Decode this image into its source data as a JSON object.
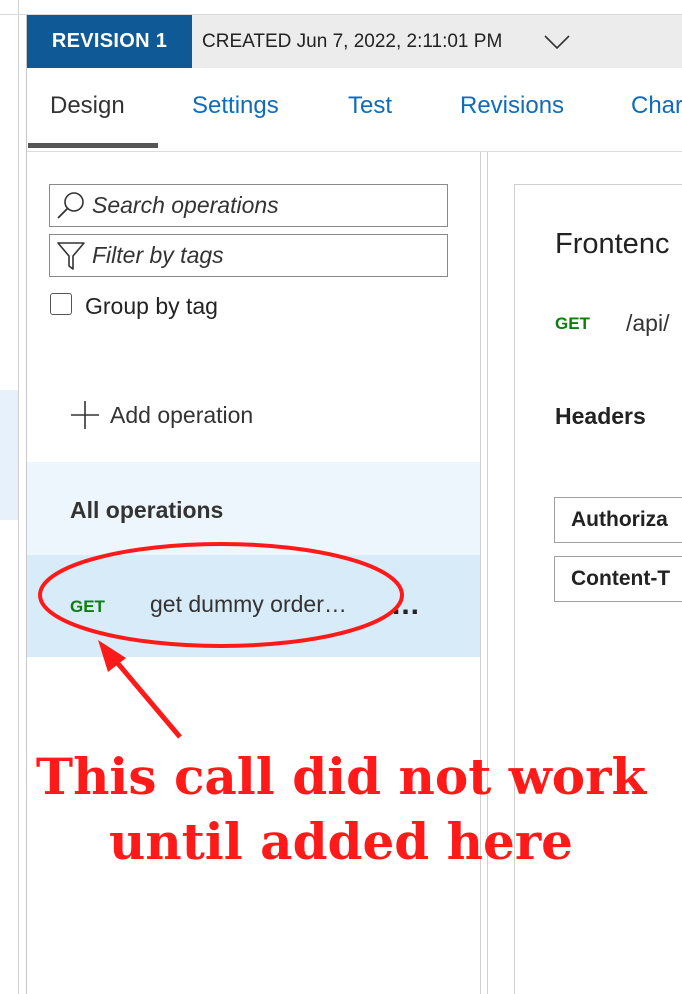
{
  "revision": {
    "badge": "REVISION 1",
    "created": "CREATED Jun 7, 2022, 2:11:01 PM"
  },
  "tabs": [
    {
      "label": "Design",
      "active": true
    },
    {
      "label": "Settings",
      "active": false
    },
    {
      "label": "Test",
      "active": false
    },
    {
      "label": "Revisions",
      "active": false
    },
    {
      "label": "Char",
      "active": false
    }
  ],
  "operations_panel": {
    "search_placeholder": "Search operations",
    "filter_placeholder": "Filter by tags",
    "group_by_tag_label": "Group by tag",
    "group_by_tag_checked": false,
    "add_operation_label": "Add operation",
    "all_operations_label": "All operations",
    "operations": [
      {
        "method": "GET",
        "name": "get dummy order…",
        "more": "..."
      }
    ]
  },
  "detail": {
    "title": "Frontenc",
    "method": "GET",
    "path": "/api/",
    "headers_label": "Headers",
    "header_rows": [
      "Authoriza",
      "Content-T"
    ]
  },
  "annotation": {
    "line1": "This call did not work",
    "line2": "until added here",
    "color": "#ff1a1a"
  },
  "colors": {
    "brand_blue": "#0f5a96",
    "link_blue": "#0f6cbd",
    "get_green": "#107c10",
    "selected_row": "#d8ebf9"
  },
  "icons": {
    "search": "search-icon",
    "filter": "filter-icon",
    "add": "plus-icon",
    "dropdown": "chevron-down-icon"
  }
}
